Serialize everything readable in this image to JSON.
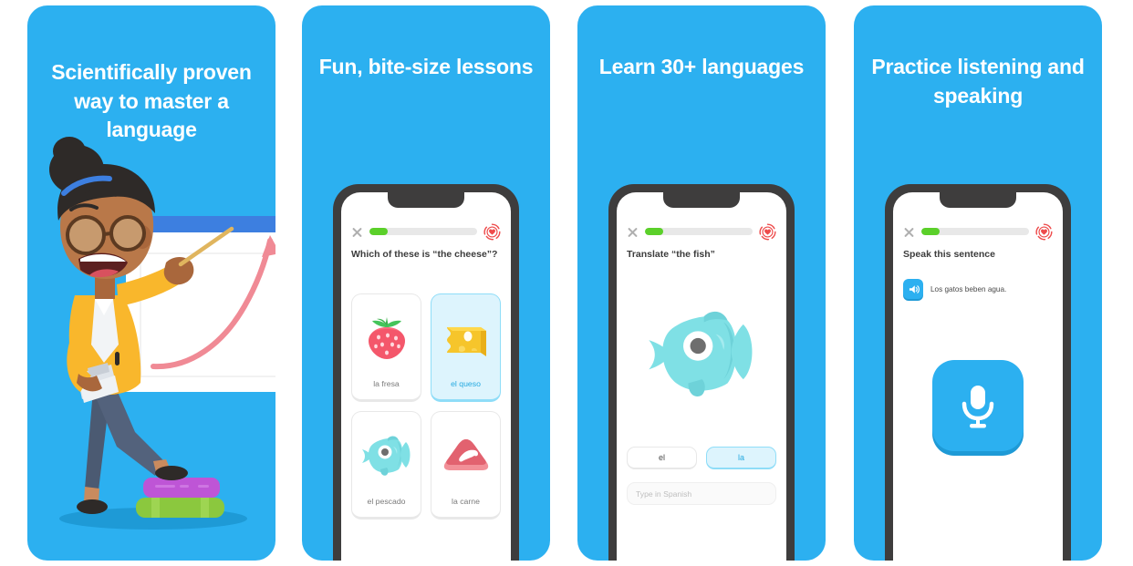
{
  "theme": {
    "brand_blue": "#2CB0F0",
    "progress_green": "#5BD02A",
    "heart_red": "#EE4B4B",
    "selected_fill": "#DDF4FD",
    "selected_border": "#8FDDF8",
    "selected_text": "#25A9E0",
    "phone_frame": "#3E3D3D"
  },
  "panels": [
    {
      "id": "panel-1",
      "headline": "Scientifically proven way to master a language",
      "illustration": "teacher-pointing-at-growth-chart"
    },
    {
      "id": "panel-2",
      "headline": "Fun, bite-size lessons",
      "screen": {
        "close_icon": "close-icon",
        "progress_percent": 17,
        "hearts_icon": "heart-icon",
        "prompt": "Which of these is “the cheese”?",
        "tiles": [
          {
            "label": "la fresa",
            "art": "strawberry-icon",
            "selected": false
          },
          {
            "label": "el queso",
            "art": "cheese-icon",
            "selected": true
          },
          {
            "label": "el pescado",
            "art": "fish-icon",
            "selected": false
          },
          {
            "label": "la carne",
            "art": "meat-icon",
            "selected": false
          }
        ]
      }
    },
    {
      "id": "panel-3",
      "headline": "Learn 30+ languages",
      "screen": {
        "close_icon": "close-icon",
        "progress_percent": 17,
        "hearts_icon": "heart-icon",
        "prompt": "Translate “the fish”",
        "art": "fish-icon",
        "word_chips": [
          {
            "label": "el",
            "selected": false
          },
          {
            "label": "la",
            "selected": true
          }
        ],
        "input_placeholder": "Type in Spanish",
        "input_value": ""
      }
    },
    {
      "id": "panel-4",
      "headline": "Practice listening and speaking",
      "screen": {
        "close_icon": "close-icon",
        "progress_percent": 17,
        "hearts_icon": "heart-icon",
        "prompt": "Speak this sentence",
        "speaker_icon": "speaker-icon",
        "sentence": "Los gatos beben agua.",
        "mic_icon": "microphone-icon"
      }
    }
  ]
}
